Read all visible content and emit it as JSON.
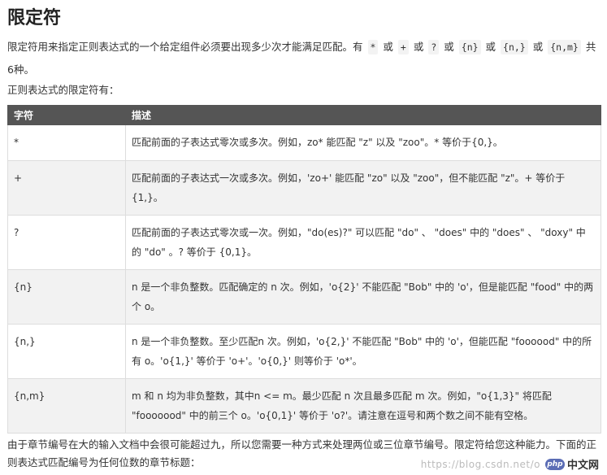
{
  "heading": "限定符",
  "intro": {
    "text_before": "限定符用来指定正则表达式的一个给定组件必须要出现多少次才能满足匹配。有",
    "q1": "*",
    "or1": "或",
    "q2": "+",
    "or2": "或",
    "q3": "?",
    "or3": "或",
    "q4": "{n}",
    "or4": "或",
    "q5": "{n,}",
    "or5": "或",
    "q6": "{n,m}",
    "text_after": "共6种。"
  },
  "subheading": "正则表达式的限定符有：",
  "table": {
    "headers": [
      "字符",
      "描述"
    ],
    "rows": [
      {
        "symbol": "*",
        "desc": "匹配前面的子表达式零次或多次。例如，zo* 能匹配 \"z\" 以及 \"zoo\"。* 等价于{0,}。"
      },
      {
        "symbol": "+",
        "desc": "匹配前面的子表达式一次或多次。例如，'zo+' 能匹配 \"zo\" 以及 \"zoo\"，但不能匹配 \"z\"。+ 等价于 {1,}。"
      },
      {
        "symbol": "?",
        "desc": "匹配前面的子表达式零次或一次。例如，\"do(es)?\" 可以匹配 \"do\" 、 \"does\" 中的 \"does\" 、 \"doxy\" 中的 \"do\" 。? 等价于 {0,1}。"
      },
      {
        "symbol": "{n}",
        "desc": "n 是一个非负整数。匹配确定的 n 次。例如，'o{2}' 不能匹配 \"Bob\" 中的 'o'，但是能匹配 \"food\" 中的两个 o。"
      },
      {
        "symbol": "{n,}",
        "desc": "n 是一个非负整数。至少匹配n 次。例如，'o{2,}' 不能匹配 \"Bob\" 中的 'o'，但能匹配 \"foooood\" 中的所有 o。'o{1,}' 等价于 'o+'。'o{0,}' 则等价于 'o*'。"
      },
      {
        "symbol": "{n,m}",
        "desc": "m 和 n 均为非负整数，其中n <= m。最少匹配 n 次且最多匹配 m 次。例如，\"o{1,3}\" 将匹配 \"fooooood\" 中的前三个 o。'o{0,1}' 等价于 'o?'。请注意在逗号和两个数之间不能有空格。"
      }
    ]
  },
  "footer": "由于章节编号在大的输入文档中会很可能超过九，所以您需要一种方式来处理两位或三位章节编号。限定符给您这种能力。下面的正则表达式匹配编号为任何位数的章节标题：",
  "watermark": {
    "url": "https://blog.csdn.net/o",
    "badge": "php",
    "site": "中文网"
  }
}
